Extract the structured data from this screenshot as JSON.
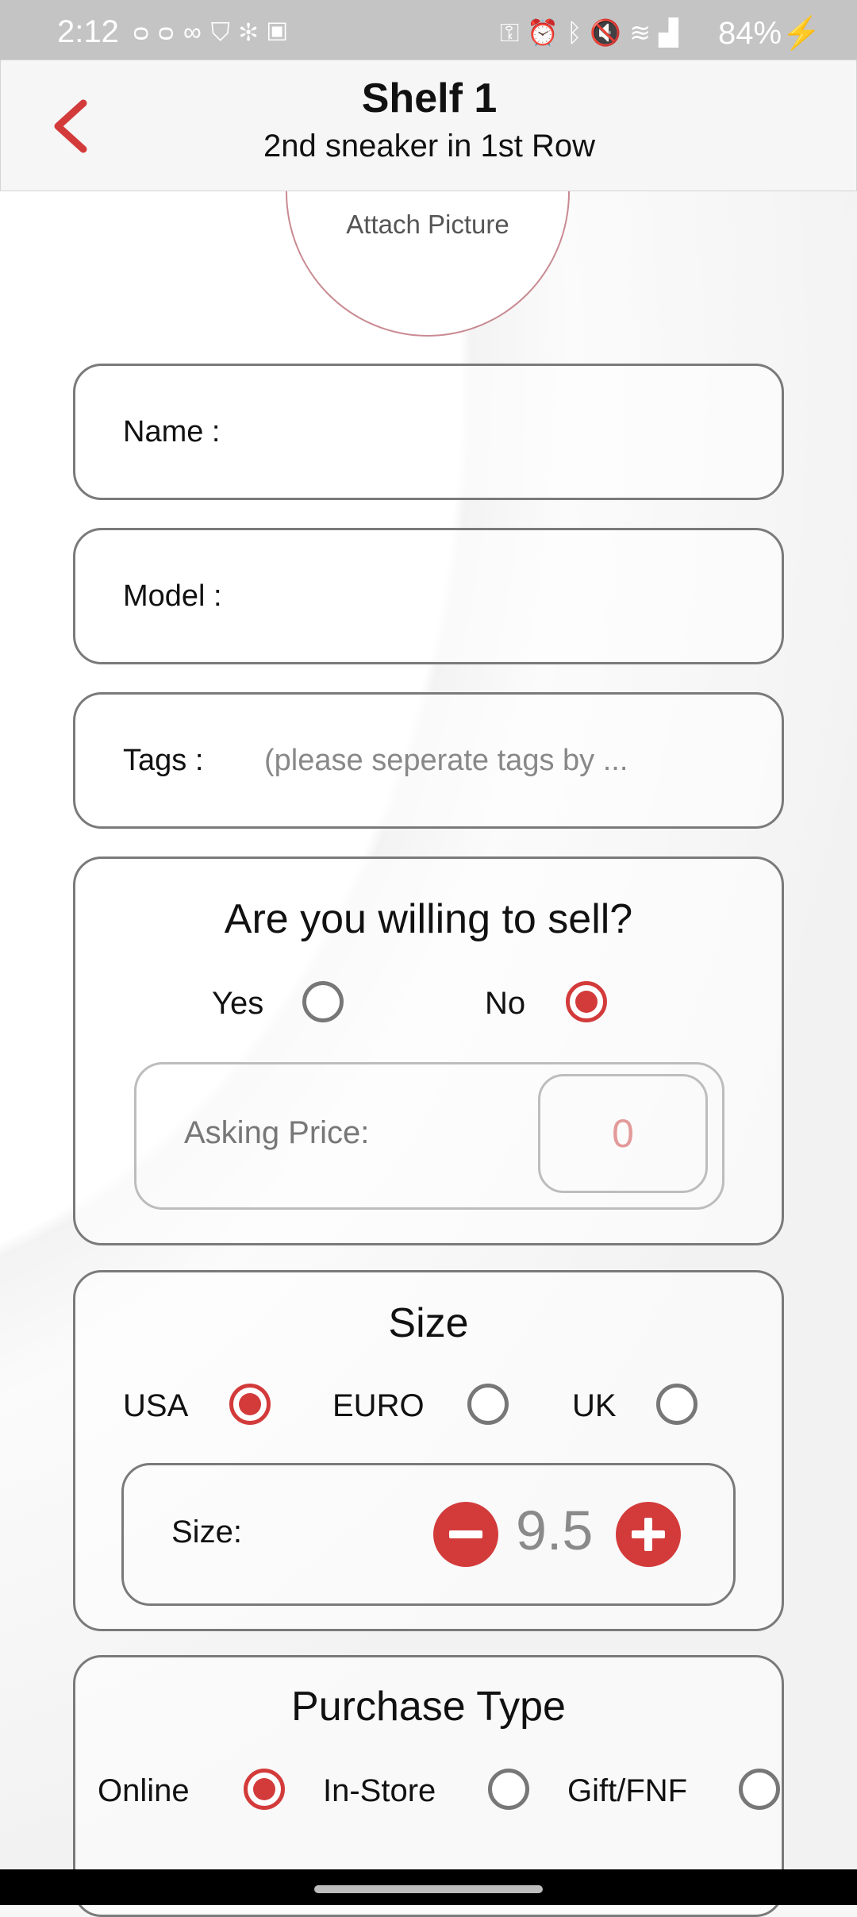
{
  "status_bar": {
    "time": "2:12",
    "battery": "84%",
    "left_icons": [
      "voicemail-icon",
      "infinity-icon",
      "shield-icon",
      "fan-icon",
      "image-icon"
    ],
    "right_icons": [
      "key-icon",
      "alarm-icon",
      "bluetooth-icon",
      "mute-icon",
      "wifi-icon",
      "signal-icon"
    ]
  },
  "header": {
    "title": "Shelf 1",
    "subtitle": "2nd sneaker in 1st Row"
  },
  "attach": {
    "label": "Attach Picture"
  },
  "fields": {
    "name": {
      "label": "Name :",
      "value": ""
    },
    "model": {
      "label": "Model :",
      "value": ""
    },
    "tags": {
      "label": "Tags :",
      "placeholder": "(please seperate tags by ..."
    }
  },
  "sell": {
    "title": "Are you willing to sell?",
    "yes_label": "Yes",
    "no_label": "No",
    "selected": "No",
    "asking_price_label": "Asking Price:",
    "asking_price_value": "0"
  },
  "size": {
    "title": "Size",
    "options": [
      "USA",
      "EURO",
      "UK"
    ],
    "selected": "USA",
    "size_label": "Size:",
    "value": "9.5"
  },
  "purchase": {
    "title": "Purchase Type",
    "options": [
      "Online",
      "In-Store",
      "Gift/FNF"
    ],
    "selected": "Online"
  },
  "colors": {
    "accent": "#d33b3b",
    "border": "#7a7a7a"
  }
}
